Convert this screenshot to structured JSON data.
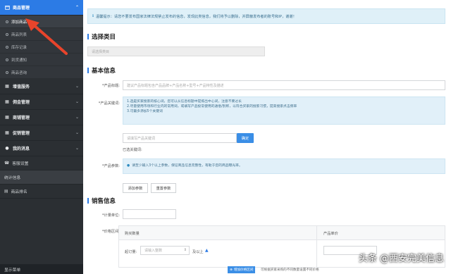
{
  "sidebar": {
    "goods_group": "商品管理",
    "goods_items": [
      "添加商品",
      "商品列表",
      "库存记录",
      "到货通知",
      "商品咨询"
    ],
    "groups": [
      "增值服务",
      "佣金管理",
      "商铺管理",
      "促销管理",
      "我的消息"
    ],
    "plain_items": [
      "客服设置",
      "统计信息",
      "商品排名"
    ],
    "footer": "显示菜单"
  },
  "notice": "温馨提示：请您不要发布国家法律法规禁止发布的信息，发现此类信息，我们将予以删除，并屏蔽发布者的账号和IP，谢谢！",
  "section_category": {
    "title": "选择类目",
    "placeholder": "请选择类目"
  },
  "section_basic": {
    "title": "基本信息",
    "name_label": "*产品标题:",
    "name_placeholder": "建议产品标题包含产品品牌+产品名称+型号+产品特性及描述",
    "keywords_label": "*产品关键词:",
    "keyword_tips": [
      "1.选是买家搜索的核心词，您可以从信息标题中提炼出中心词，注意不要过长",
      "2.尽量使用市场和行业内的常用词，或填写产品投常使用的通俗/别称，以符合买家的搜索习惯，提高搜索点击频率",
      "3.可最多添加5个关键词"
    ],
    "keyword_input_placeholder": "请填写产品关键词",
    "confirm_btn": "确定",
    "selected_label": "已选关键词:",
    "params_label": "*产品参数:",
    "params_tip": "请至少输入3个以上参数，保证商品信息完整性，有助于您的商品曝光率。",
    "add_param_btn": "添加参数",
    "reset_param_btn": "重置参数"
  },
  "section_sales": {
    "title": "销售信息",
    "unit_label": "*计量单位:",
    "price_label": "*价格区间:",
    "col_qty": "购买数量",
    "col_price": "产品单价",
    "min_order_label": "起订量:",
    "min_order_placeholder": "请输入整数",
    "min_order_suffix": "及以上",
    "add_price_btn": "增加价格区间",
    "add_price_note": "可根据买家采购的不同数量设置不同价格"
  },
  "watermark": "头条 @西安完美信息",
  "colors": {
    "sidebar_bg": "#2b2f33",
    "accent": "#2c7be5",
    "notice_bg": "#dff0f8",
    "arrow": "#e8442b"
  }
}
